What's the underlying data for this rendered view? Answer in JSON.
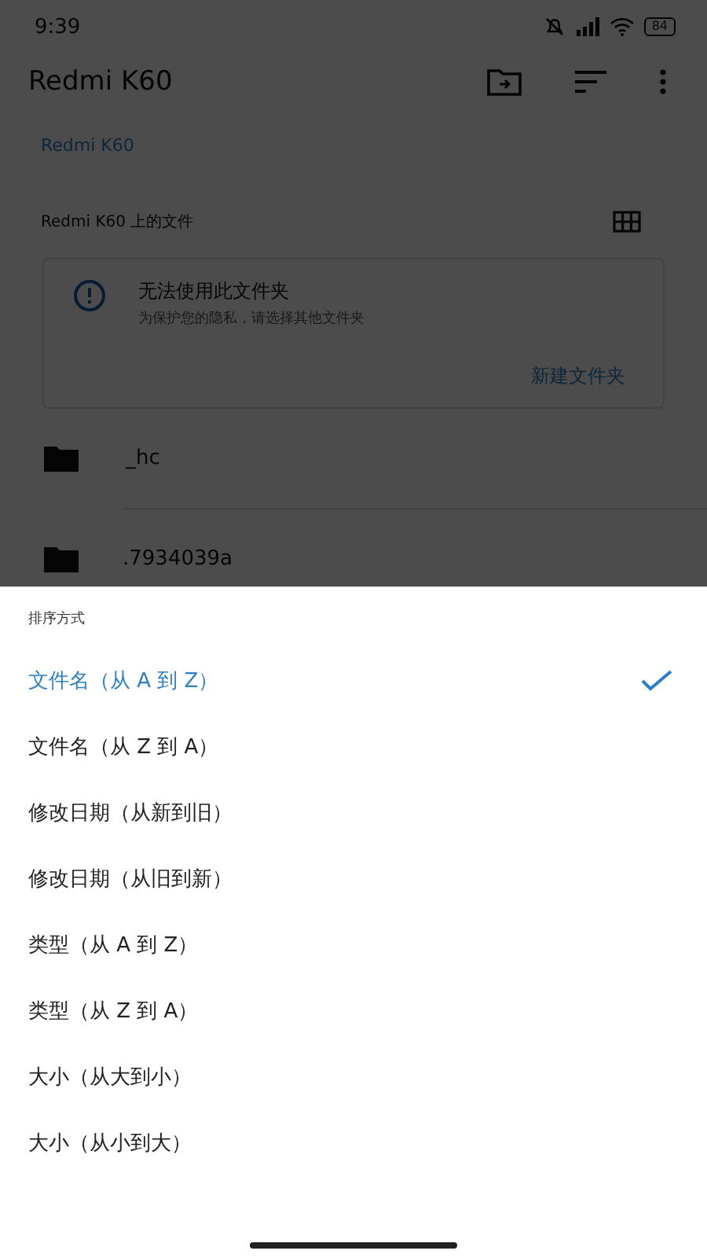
{
  "status_bar": {
    "time": "9:39",
    "battery": "84"
  },
  "app_bar": {
    "title": "Redmi K60"
  },
  "breadcrumb": "Redmi K60",
  "section": {
    "title": "Redmi K60 上的文件"
  },
  "notice": {
    "title": "无法使用此文件夹",
    "message": "为保护您的隐私，请选择其他文件夹",
    "action": "新建文件夹"
  },
  "files": [
    {
      "name": "_hc"
    },
    {
      "name": ".7934039a"
    }
  ],
  "sort_sheet": {
    "title": "排序方式",
    "options": [
      {
        "label": "文件名（从 A 到 Z）",
        "selected": true
      },
      {
        "label": "文件名（从 Z 到 A）",
        "selected": false
      },
      {
        "label": "修改日期（从新到旧）",
        "selected": false
      },
      {
        "label": "修改日期（从旧到新）",
        "selected": false
      },
      {
        "label": "类型（从 A 到 Z）",
        "selected": false
      },
      {
        "label": "类型（从 Z 到 A）",
        "selected": false
      },
      {
        "label": "大小（从大到小）",
        "selected": false
      },
      {
        "label": "大小（从小到大）",
        "selected": false
      }
    ]
  }
}
